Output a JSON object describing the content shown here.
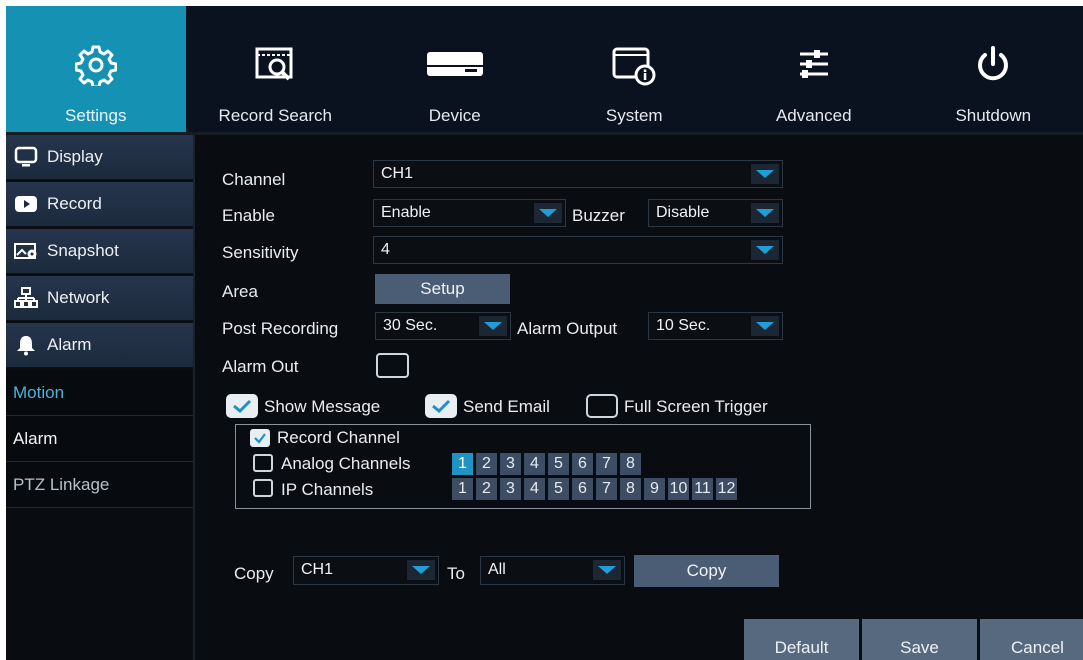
{
  "nav": {
    "tabs": [
      {
        "label": "Settings",
        "icon": "gear-icon"
      },
      {
        "label": "Record Search",
        "icon": "record-search-icon"
      },
      {
        "label": "Device",
        "icon": "hdd-icon"
      },
      {
        "label": "System",
        "icon": "system-info-icon"
      },
      {
        "label": "Advanced",
        "icon": "sliders-icon"
      },
      {
        "label": "Shutdown",
        "icon": "power-icon"
      }
    ],
    "active_tab": "Settings"
  },
  "sidebar": {
    "items": [
      {
        "label": "Display",
        "icon": "monitor-icon"
      },
      {
        "label": "Record",
        "icon": "record-icon"
      },
      {
        "label": "Snapshot",
        "icon": "snapshot-icon"
      },
      {
        "label": "Network",
        "icon": "network-icon"
      },
      {
        "label": "Alarm",
        "icon": "bell-icon"
      }
    ],
    "subitems": [
      {
        "label": "Motion",
        "state": "active"
      },
      {
        "label": "Alarm",
        "state": "normal"
      },
      {
        "label": "PTZ Linkage",
        "state": "dim"
      }
    ]
  },
  "form": {
    "channel": {
      "label": "Channel",
      "value": "CH1"
    },
    "enable": {
      "label": "Enable",
      "value": "Enable"
    },
    "buzzer": {
      "label": "Buzzer",
      "value": "Disable"
    },
    "sensitivity": {
      "label": "Sensitivity",
      "value": "4"
    },
    "area": {
      "label": "Area",
      "button": "Setup"
    },
    "post_recording": {
      "label": "Post Recording",
      "value": "30 Sec."
    },
    "alarm_output": {
      "label": "Alarm Output",
      "value": "10 Sec."
    },
    "alarm_out": {
      "label": "Alarm Out",
      "checked": false
    },
    "show_message": {
      "label": "Show Message",
      "checked": true
    },
    "send_email": {
      "label": "Send Email",
      "checked": true
    },
    "full_screen_trigger": {
      "label": "Full Screen Trigger",
      "checked": false
    },
    "record_channel": {
      "label": "Record Channel",
      "checked": true
    },
    "analog_channels": {
      "label": "Analog Channels",
      "checked": false,
      "numbers": [
        "1",
        "2",
        "3",
        "4",
        "5",
        "6",
        "7",
        "8"
      ],
      "selected": "1"
    },
    "ip_channels": {
      "label": "IP Channels",
      "checked": false,
      "numbers": [
        "1",
        "2",
        "3",
        "4",
        "5",
        "6",
        "7",
        "8",
        "9",
        "10",
        "11",
        "12"
      ]
    }
  },
  "copy": {
    "label": "Copy",
    "from_value": "CH1",
    "to_label": "To",
    "to_value": "All",
    "button": "Copy"
  },
  "footer": {
    "default": "Default",
    "save": "Save",
    "cancel": "Cancel"
  },
  "colors": {
    "accent": "#1591b4",
    "highlight_text": "#4ab4d8",
    "dropdown_arrow": "#1f9fd8",
    "selected_channel": "#1e93c4",
    "button_bg": "#4b5d74"
  }
}
